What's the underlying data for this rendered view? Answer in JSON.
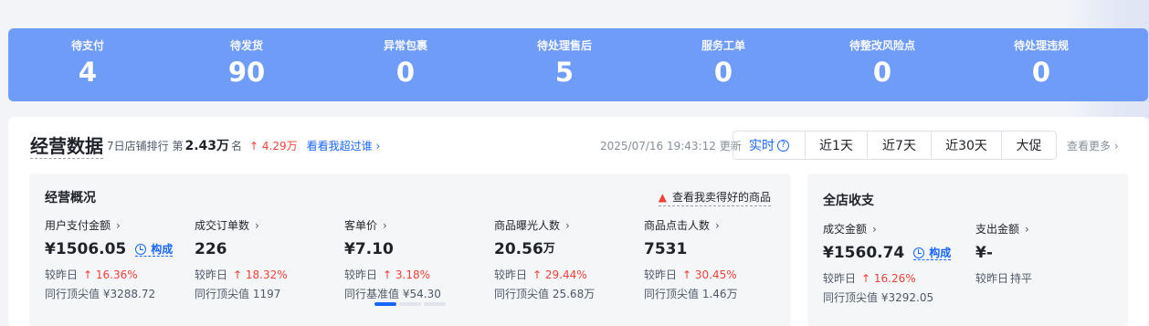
{
  "summary": [
    {
      "label": "待支付",
      "value": "4"
    },
    {
      "label": "待发货",
      "value": "90"
    },
    {
      "label": "异常包裹",
      "value": "0"
    },
    {
      "label": "待处理售后",
      "value": "5"
    },
    {
      "label": "服务工单",
      "value": "0"
    },
    {
      "label": "待整改风险点",
      "value": "0"
    },
    {
      "label": "待处理违规",
      "value": "0"
    }
  ],
  "header": {
    "title": "经营数据",
    "rank_prefix": "7日店铺排行 第",
    "rank_value": "2.43万",
    "rank_suffix": "名",
    "rank_change": "↑ 4.29万",
    "rank_link": "看看我超过谁",
    "rank_link_chevron": "›",
    "updated": "2025/07/16 19:43:12 更新",
    "more": "查看更多",
    "more_chevron": "›"
  },
  "tabs": [
    {
      "label": "实时",
      "help": "?"
    },
    {
      "label": "近1天"
    },
    {
      "label": "近7天"
    },
    {
      "label": "近30天"
    },
    {
      "label": "大促"
    }
  ],
  "overview": {
    "title": "经营概况",
    "hot_icon": "flame-icon",
    "hot_link": "查看我卖得好的商品",
    "compose_label": "构成",
    "metrics": [
      {
        "label": "用户支付金额",
        "value": "¥1506.05",
        "unit": "",
        "has_compose": true,
        "delta_label": "较昨日",
        "delta": "↑ 16.36%",
        "peer_label": "同行顶尖值",
        "peer_value": "¥3288.72"
      },
      {
        "label": "成交订单数",
        "value": "226",
        "unit": "",
        "has_compose": false,
        "delta_label": "较昨日",
        "delta": "↑ 18.32%",
        "peer_label": "同行顶尖值",
        "peer_value": "1197"
      },
      {
        "label": "客单价",
        "value": "¥7.10",
        "unit": "",
        "has_compose": false,
        "delta_label": "较昨日",
        "delta": "↑ 3.18%",
        "peer_label": "同行基准值",
        "peer_value": "¥54.30"
      },
      {
        "label": "商品曝光人数",
        "value": "20.56",
        "unit": "万",
        "has_compose": false,
        "delta_label": "较昨日",
        "delta": "↑ 29.44%",
        "peer_label": "同行顶尖值",
        "peer_value": "25.68万"
      },
      {
        "label": "商品点击人数",
        "value": "7531",
        "unit": "",
        "has_compose": false,
        "delta_label": "较昨日",
        "delta": "↑ 30.45%",
        "peer_label": "同行顶尖值",
        "peer_value": "1.46万"
      }
    ],
    "pagination": {
      "pages": 3,
      "current": 1
    }
  },
  "income": {
    "title": "全店收支",
    "compose_label": "构成",
    "metrics": [
      {
        "label": "成交金额",
        "value": "¥1560.74",
        "has_compose": true,
        "delta_label": "较昨日",
        "delta": "↑ 16.26%",
        "peer_label": "同行顶尖值",
        "peer_value": "¥3292.05"
      },
      {
        "label": "支出金额",
        "value": "¥-",
        "has_compose": false,
        "delta_label": "较昨日",
        "delta": "持平",
        "peer_label": "",
        "peer_value": ""
      }
    ]
  },
  "colors": {
    "banner": "#6f9cf9",
    "accent": "#1966ff",
    "up": "#f0413a"
  }
}
